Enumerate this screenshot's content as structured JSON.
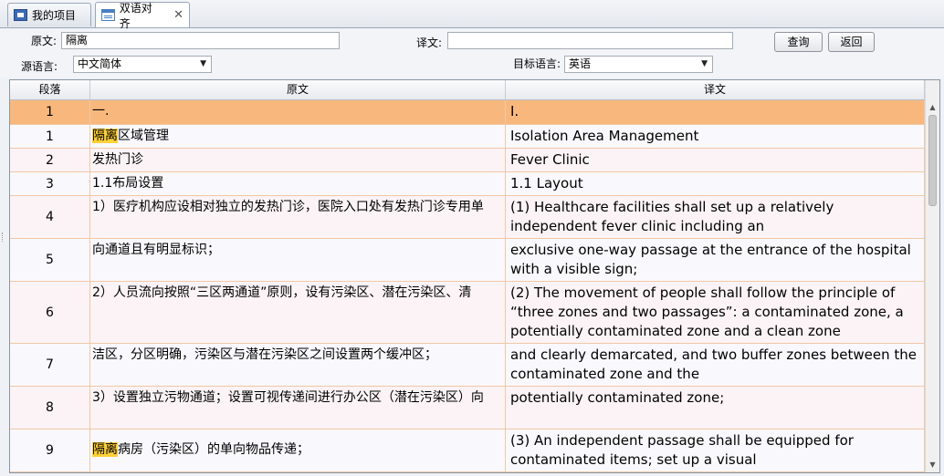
{
  "tabs": [
    {
      "label": "我的项目",
      "icon": "folder-icon"
    },
    {
      "label": "双语对齐",
      "icon": "document-icon"
    }
  ],
  "form": {
    "source_label": "原文:",
    "source_value": "隔离",
    "target_label": "译文:",
    "target_value": "",
    "query_button": "查询",
    "back_button": "返回",
    "source_lang_label": "源语言:",
    "source_lang_value": "中文简体",
    "target_lang_label": "目标语言:",
    "target_lang_value": "英语"
  },
  "grid": {
    "headers": [
      "段落",
      "原文",
      "译文"
    ],
    "rows": [
      {
        "no": "1",
        "src_hl": "",
        "src": "一.",
        "tgt": "I."
      },
      {
        "no": "1",
        "src_hl": "隔离",
        "src": "区域管理",
        "tgt": "Isolation Area Management"
      },
      {
        "no": "2",
        "src_hl": "",
        "src": "发热门诊",
        "tgt": " Fever Clinic"
      },
      {
        "no": "3",
        "src_hl": "",
        "src": "1.1布局设置",
        "tgt": "1.1 Layout"
      },
      {
        "no": "4",
        "src_hl": "",
        "src": "1）医疗机构应设相对独立的发热门诊，医院入口处有发热门诊专用单",
        "tgt": "(1) Healthcare facilities shall set up a relatively independent fever clinic including an"
      },
      {
        "no": "5",
        "src_hl": "",
        "src": "向通道且有明显标识；",
        "tgt": "exclusive one-way passage at the entrance of the hospital with a visible sign;"
      },
      {
        "no": "6",
        "src_hl": "",
        "src": "2）人员流向按照“三区两通道”原则，设有污染区、潜在污染区、清",
        "tgt": "(2) The movement of people shall follow the principle of  “three zones and two passages”: a contaminated zone, a potentially contaminated zone and a clean zone"
      },
      {
        "no": "7",
        "src_hl": "",
        "src": "洁区，分区明确，污染区与潜在污染区之间设置两个缓冲区；",
        "tgt": "and clearly demarcated, and two buffer zones between the contaminated zone and the"
      },
      {
        "no": "8",
        "src_hl": "",
        "src": "3）设置独立污物通道；设置可视传递间进行办公区（潜在污染区）向",
        "tgt": "potentially contaminated zone;"
      },
      {
        "no": "9",
        "src_hl": "隔离",
        "src": "病房（污染区）的单向物品传递；",
        "tgt": "(3) An independent passage shall be equipped for contaminated items; set up a visual"
      }
    ]
  }
}
